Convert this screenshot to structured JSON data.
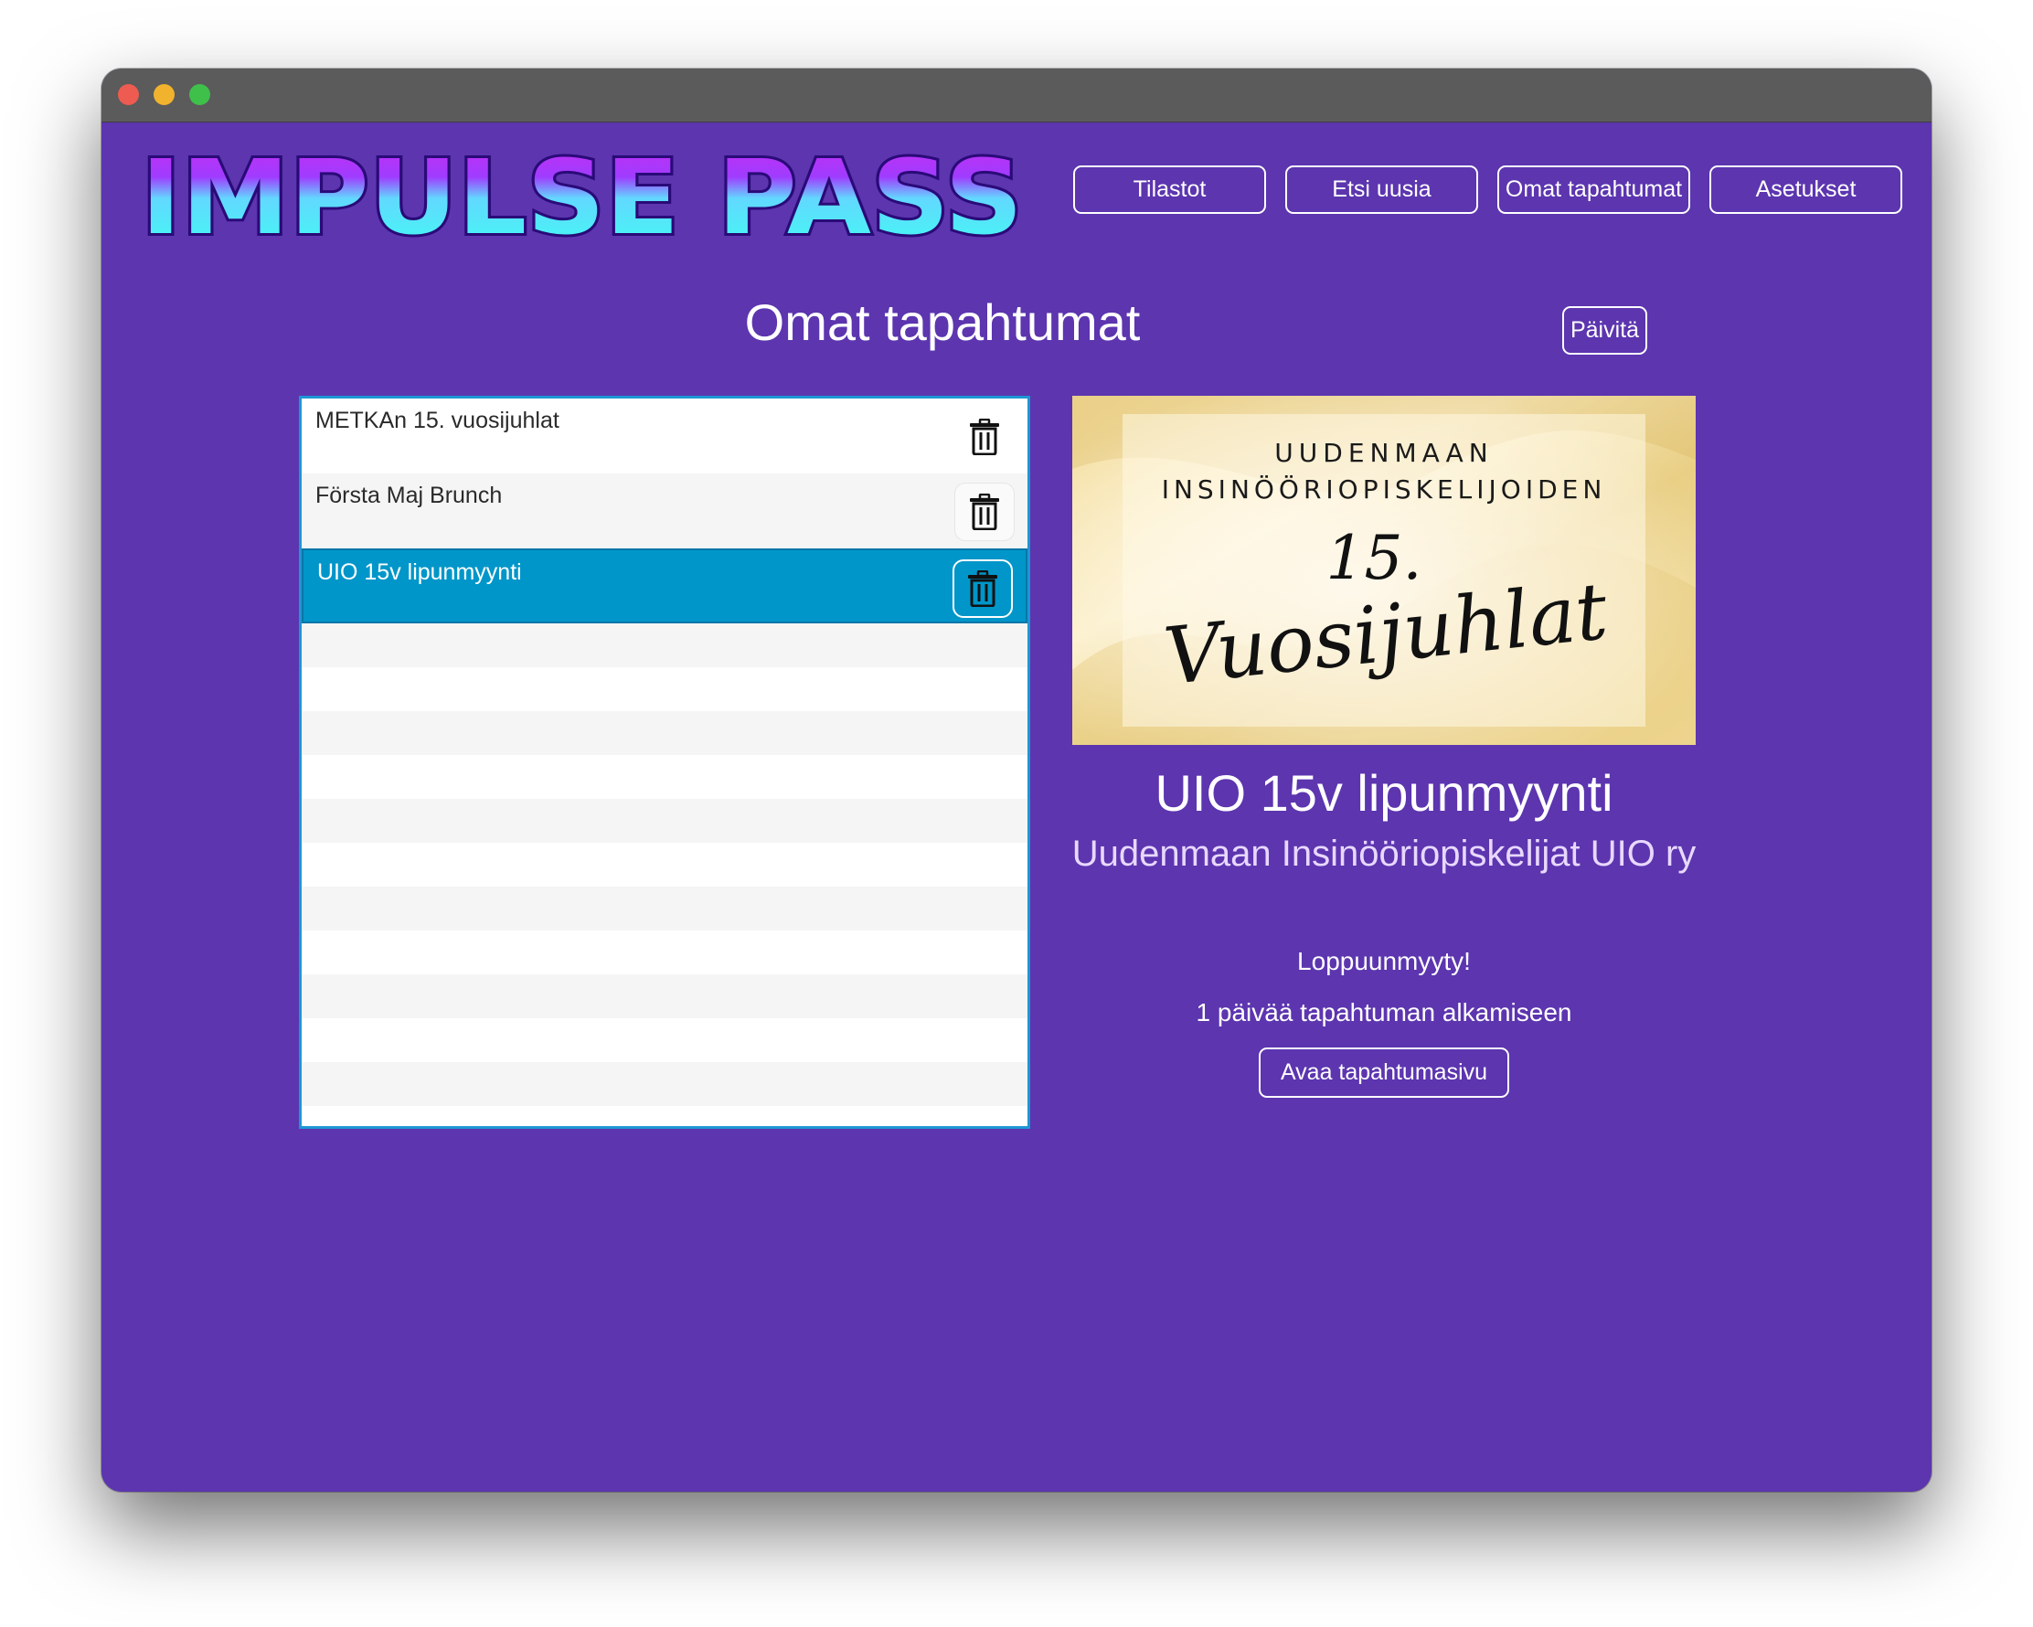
{
  "app": {
    "logo_text": "IMPULSE PASS"
  },
  "nav": {
    "items": [
      {
        "label": "Tilastot"
      },
      {
        "label": "Etsi uusia"
      },
      {
        "label": "Omat tapahtumat"
      },
      {
        "label": "Asetukset"
      }
    ]
  },
  "page": {
    "title": "Omat tapahtumat",
    "refresh_label": "Päivitä"
  },
  "events": {
    "items": [
      {
        "label": "METKAn 15. vuosijuhlat",
        "selected": false
      },
      {
        "label": "Första Maj Brunch",
        "selected": false
      },
      {
        "label": "UIO 15v lipunmyynti",
        "selected": true
      }
    ]
  },
  "banner": {
    "line1": "UUDENMAAN",
    "line2": "INSINÖÖRIOPISKELIJOIDEN",
    "number": "15.",
    "script": "Vuosijuhlat"
  },
  "detail": {
    "title": "UIO 15v lipunmyynti",
    "organizer": "Uudenmaan Insinööriopiskelijat UIO ry",
    "status": "Loppuunmyyty!",
    "days_left": "1 päivää tapahtuman alkamiseen",
    "open_label": "Avaa tapahtumasivu"
  },
  "colors": {
    "background": "#5c35af",
    "selection": "#0096c9",
    "list_border": "#1e96d4",
    "logo_top": "#c82cf0",
    "logo_bottom": "#3dfff0"
  },
  "icons": {
    "delete": "trash-icon"
  }
}
